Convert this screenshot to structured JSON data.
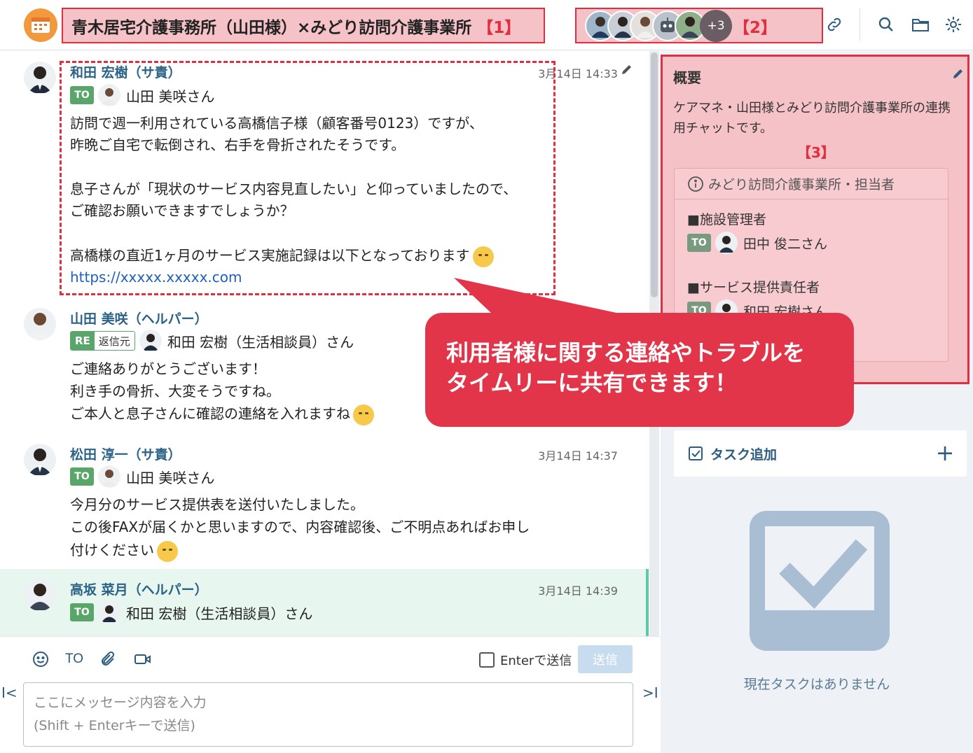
{
  "header": {
    "room_title": "青木居宅介護事務所（山田様）×みどり訪問介護事業所",
    "tag1": "【1】",
    "members_more": "+3",
    "tag2": "【2】"
  },
  "messages": [
    {
      "sender": "和田 宏樹（サ責）",
      "time": "3月14日 14:33",
      "to_badge": "TO",
      "to_name": "山田 美咲さん",
      "lines": [
        "訪問で週一利用されている高橋信子様（顧客番号0123）ですが、",
        "昨晩ご自宅で転倒され、右手を骨折されたそうです。",
        "息子さんが「現状のサービス内容見直したい」と仰っていましたので、",
        "ご確認お願いできますでしょうか？",
        "高橋様の直近1ヶ月のサービス実施記録は以下となっております"
      ],
      "link": "https://xxxxx.xxxxx.com"
    },
    {
      "sender": "山田 美咲（ヘルパー）",
      "re_badge": "RE",
      "re_text": "返信元",
      "to_name": "和田 宏樹（生活相談員）さん",
      "lines": [
        "ご連絡ありがとうございます！",
        "利き手の骨折、大変そうですね。",
        "ご本人と息子さんに確認の連絡を入れますね"
      ]
    },
    {
      "sender": "松田 淳一（サ責）",
      "time": "3月14日 14:37",
      "to_badge": "TO",
      "to_name": "山田 美咲さん",
      "lines": [
        "今月分のサービス提供表を送付いたしました。",
        "この後FAXが届くかと思いますので、内容確認後、ご不明点あればお申し",
        "付けください"
      ]
    },
    {
      "sender": "高坂 菜月（ヘルパー）",
      "time": "3月14日 14:39",
      "to_badge": "TO",
      "to_name": "和田 宏樹（生活相談員）さん"
    }
  ],
  "composer": {
    "to_label": "TO",
    "enter_label": "Enterで送信",
    "send_label": "送信",
    "placeholder": "ここにメッセージ内容を入力\n(Shift + Enterキーで送信)"
  },
  "sidebar": {
    "overview_title": "概要",
    "overview_desc": "ケアマネ・山田様とみどり訪問介護事業所の連携用チャットです。",
    "tag3": "【3】",
    "info_head": "みどり訪問介護事業所・担当者",
    "section1": "■施設管理者",
    "section1_to": "TO",
    "section1_name": "田中 俊二さん",
    "section2": "■サービス提供責任者",
    "section2_to": "TO",
    "section2_name": "和田 宏樹さん",
    "task_label": "タスク追加",
    "no_tasks": "現在タスクはありません"
  },
  "callout": {
    "line1": "利用者様に関する連絡やトラブルを",
    "line2": "タイムリーに共有できます！"
  },
  "colors": {
    "accent_red": "#e0303f",
    "to_green": "#5aa56a",
    "sender_blue": "#2b6387",
    "callout_red": "#e2354a"
  }
}
